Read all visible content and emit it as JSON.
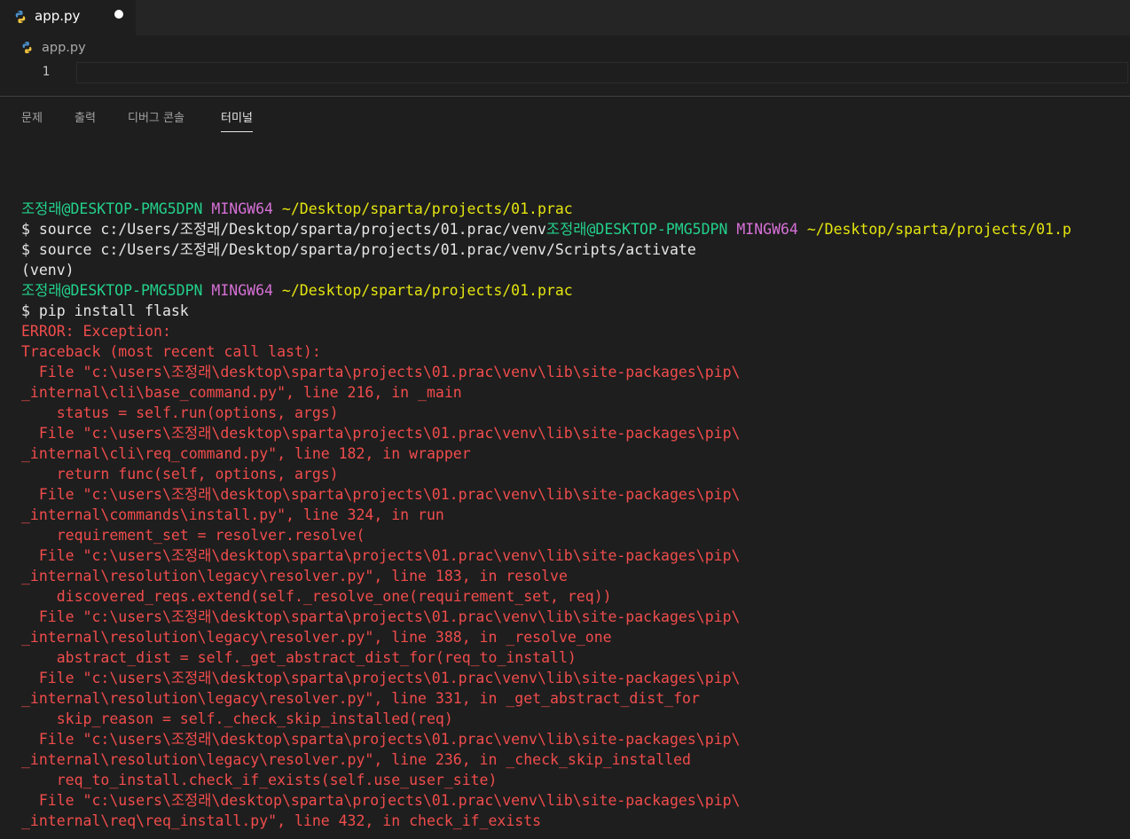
{
  "colors": {
    "editor_bg": "#1e1e1e",
    "tabbar_bg": "#252526",
    "prompt_user": "#23d18b",
    "prompt_host_type": "#d670d6",
    "prompt_path": "#e5e510",
    "error": "#f14c4c",
    "terminal_text": "#cccccc"
  },
  "editor_tab": {
    "label": "app.py",
    "icon": "python-icon",
    "unsaved_indicator": "dot"
  },
  "breadcrumb": {
    "label": "app.py",
    "icon": "python-icon"
  },
  "editor": {
    "line_numbers": [
      "1"
    ]
  },
  "panel": {
    "tabs": [
      {
        "label": "문제",
        "active": false
      },
      {
        "label": "출력",
        "active": false
      },
      {
        "label": "디버그 콘솔",
        "active": false
      },
      {
        "label": "터미널",
        "active": true
      }
    ]
  },
  "terminal": {
    "lines": [
      {
        "segments": [
          {
            "t": "조정래@DESKTOP-PMG5DPN",
            "c": "green"
          },
          {
            "t": " ",
            "c": "white"
          },
          {
            "t": "MINGW64",
            "c": "magenta"
          },
          {
            "t": " ",
            "c": "white"
          },
          {
            "t": "~/Desktop/sparta/projects/01.prac",
            "c": "yellow"
          }
        ]
      },
      {
        "segments": [
          {
            "t": "$ source c:/Users/조정래/Desktop/sparta/projects/01.prac/venv",
            "c": "white"
          },
          {
            "t": "조정래@DESKTOP-PMG5DPN",
            "c": "green"
          },
          {
            "t": " ",
            "c": "white"
          },
          {
            "t": "MINGW64",
            "c": "magenta"
          },
          {
            "t": " ",
            "c": "white"
          },
          {
            "t": "~/Desktop/sparta/projects/01.p",
            "c": "yellow"
          }
        ]
      },
      {
        "segments": [
          {
            "t": "$ source c:/Users/조정래/Desktop/sparta/projects/01.prac/venv/Scripts/activate",
            "c": "white"
          }
        ]
      },
      {
        "segments": [
          {
            "t": "(venv)",
            "c": "white"
          }
        ]
      },
      {
        "segments": [
          {
            "t": "조정래@DESKTOP-PMG5DPN",
            "c": "green"
          },
          {
            "t": " ",
            "c": "white"
          },
          {
            "t": "MINGW64",
            "c": "magenta"
          },
          {
            "t": " ",
            "c": "white"
          },
          {
            "t": "~/Desktop/sparta/projects/01.prac",
            "c": "yellow"
          }
        ]
      },
      {
        "segments": [
          {
            "t": "$ pip install flask",
            "c": "white"
          }
        ]
      },
      {
        "segments": [
          {
            "t": "ERROR: Exception:",
            "c": "red"
          }
        ]
      },
      {
        "segments": [
          {
            "t": "Traceback (most recent call last):",
            "c": "red"
          }
        ]
      },
      {
        "segments": [
          {
            "t": "  File \"c:\\users\\조정래\\desktop\\sparta\\projects\\01.prac\\venv\\lib\\site-packages\\pip\\",
            "c": "red"
          }
        ]
      },
      {
        "segments": [
          {
            "t": "_internal\\cli\\base_command.py\", line 216, in _main",
            "c": "red"
          }
        ]
      },
      {
        "segments": [
          {
            "t": "    status = self.run(options, args)",
            "c": "red"
          }
        ]
      },
      {
        "segments": [
          {
            "t": "  File \"c:\\users\\조정래\\desktop\\sparta\\projects\\01.prac\\venv\\lib\\site-packages\\pip\\",
            "c": "red"
          }
        ]
      },
      {
        "segments": [
          {
            "t": "_internal\\cli\\req_command.py\", line 182, in wrapper",
            "c": "red"
          }
        ]
      },
      {
        "segments": [
          {
            "t": "    return func(self, options, args)",
            "c": "red"
          }
        ]
      },
      {
        "segments": [
          {
            "t": "  File \"c:\\users\\조정래\\desktop\\sparta\\projects\\01.prac\\venv\\lib\\site-packages\\pip\\",
            "c": "red"
          }
        ]
      },
      {
        "segments": [
          {
            "t": "_internal\\commands\\install.py\", line 324, in run",
            "c": "red"
          }
        ]
      },
      {
        "segments": [
          {
            "t": "    requirement_set = resolver.resolve(",
            "c": "red"
          }
        ]
      },
      {
        "segments": [
          {
            "t": "  File \"c:\\users\\조정래\\desktop\\sparta\\projects\\01.prac\\venv\\lib\\site-packages\\pip\\",
            "c": "red"
          }
        ]
      },
      {
        "segments": [
          {
            "t": "_internal\\resolution\\legacy\\resolver.py\", line 183, in resolve",
            "c": "red"
          }
        ]
      },
      {
        "segments": [
          {
            "t": "    discovered_reqs.extend(self._resolve_one(requirement_set, req))",
            "c": "red"
          }
        ]
      },
      {
        "segments": [
          {
            "t": "  File \"c:\\users\\조정래\\desktop\\sparta\\projects\\01.prac\\venv\\lib\\site-packages\\pip\\",
            "c": "red"
          }
        ]
      },
      {
        "segments": [
          {
            "t": "_internal\\resolution\\legacy\\resolver.py\", line 388, in _resolve_one",
            "c": "red"
          }
        ]
      },
      {
        "segments": [
          {
            "t": "    abstract_dist = self._get_abstract_dist_for(req_to_install)",
            "c": "red"
          }
        ]
      },
      {
        "segments": [
          {
            "t": "  File \"c:\\users\\조정래\\desktop\\sparta\\projects\\01.prac\\venv\\lib\\site-packages\\pip\\",
            "c": "red"
          }
        ]
      },
      {
        "segments": [
          {
            "t": "_internal\\resolution\\legacy\\resolver.py\", line 331, in _get_abstract_dist_for",
            "c": "red"
          }
        ]
      },
      {
        "segments": [
          {
            "t": "    skip_reason = self._check_skip_installed(req)",
            "c": "red"
          }
        ]
      },
      {
        "segments": [
          {
            "t": "  File \"c:\\users\\조정래\\desktop\\sparta\\projects\\01.prac\\venv\\lib\\site-packages\\pip\\",
            "c": "red"
          }
        ]
      },
      {
        "segments": [
          {
            "t": "_internal\\resolution\\legacy\\resolver.py\", line 236, in _check_skip_installed",
            "c": "red"
          }
        ]
      },
      {
        "segments": [
          {
            "t": "    req_to_install.check_if_exists(self.use_user_site)",
            "c": "red"
          }
        ]
      },
      {
        "segments": [
          {
            "t": "  File \"c:\\users\\조정래\\desktop\\sparta\\projects\\01.prac\\venv\\lib\\site-packages\\pip\\",
            "c": "red"
          }
        ]
      },
      {
        "segments": [
          {
            "t": "_internal\\req\\req_install.py\", line 432, in check_if_exists",
            "c": "red"
          }
        ]
      }
    ]
  }
}
